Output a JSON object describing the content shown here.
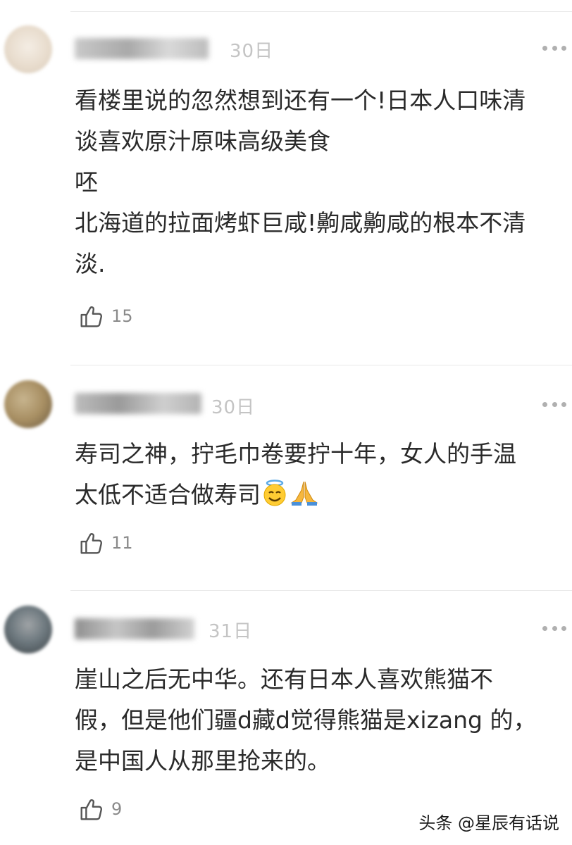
{
  "comments": [
    {
      "date": "30日",
      "text": "看楼里说的忽然想到还有一个!日本人口味清\n谈喜欢原汁原味高级美食\n呸\n北海道的拉面烤虾巨咸!齁咸齁咸的根本不清\n淡.",
      "likes": "15"
    },
    {
      "date": "30日",
      "text": "寿司之神，拧毛巾卷要拧十年，女人的手温\n太低不适合做寿司",
      "likes": "11"
    },
    {
      "date": "31日",
      "text": "崖山之后无中华。还有日本人喜欢熊猫不\n假，但是他们疆d藏d觉得熊猫是xizang 的，\n是中国人从那里抢来的。",
      "likes": "9"
    }
  ],
  "icons": {
    "like": "thumbs-up-icon",
    "more": "more-dots-icon",
    "emoji_halo": "smiling-face-with-halo",
    "emoji_pray": "folded-hands"
  },
  "watermark": {
    "text": "头条 @星辰有话说"
  }
}
